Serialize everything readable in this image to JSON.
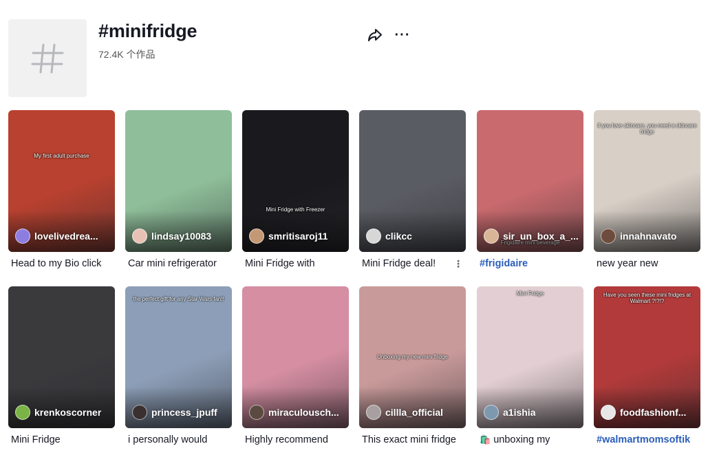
{
  "header": {
    "icon": "hashtag-icon",
    "title": "#minifridge",
    "count": "72.4K 个作品",
    "share_icon": "share-icon",
    "more_icon": "more-icon",
    "more_glyph": "···"
  },
  "videos": [
    {
      "user": "lovelivedrea...",
      "caption": "Head to my Bio click",
      "overlay": "My first adult purchase",
      "bg": "#b9412f",
      "avatar": "#8e7de0"
    },
    {
      "user": "lindsay10083",
      "caption": "Car mini refrigerator",
      "overlay": "",
      "bg": "#8fbf9a",
      "avatar": "#e7c2b4"
    },
    {
      "user": "smritisaroj11",
      "caption": "Mini Fridge with",
      "overlay": "Mini Fridge with Freezer",
      "bg": "#1a1a1e",
      "avatar": "#c49873"
    },
    {
      "user": "clikcc",
      "caption": "Mini Fridge deal!",
      "overlay": "",
      "bg": "#5a5c63",
      "avatar": "#d7d7d7"
    },
    {
      "user": "sir_un_box_a_...",
      "caption": "#frigidaire",
      "overlay": "Frigidaire mini beverage",
      "bg": "#c96a6e",
      "avatar": "#d9b598"
    },
    {
      "user": "innahnavato",
      "caption": "new year new",
      "overlay": "if you love skincare, you need a skincare fridge",
      "bg": "#d8cfc6",
      "avatar": "#6d4b3d"
    },
    {
      "user": "krenkoscorner",
      "caption": "Mini Fridge",
      "overlay": "",
      "bg": "#3a3a3d",
      "avatar": "#7bb346"
    },
    {
      "user": "princess_jpuff",
      "caption": "i personally would",
      "overlay": "the perfect gift for any Star Wars fan!!",
      "bg": "#8d9fb8",
      "avatar": "#3b3030"
    },
    {
      "user": "miraculousch...",
      "caption": "Highly recommend",
      "overlay": "",
      "bg": "#d58ea2",
      "avatar": "#5b4a40"
    },
    {
      "user": "cillla_official",
      "caption": "This exact mini fridge",
      "overlay": "Unboxing my new mini fridge",
      "bg": "#c99a9a",
      "avatar": "#a8a0a0"
    },
    {
      "user": "a1ishia",
      "caption": "unboxing my",
      "overlay": "Mini Fridge",
      "bg": "#e3cfd3",
      "avatar": "#7e98b0"
    },
    {
      "user": "foodfashionf...",
      "caption": "#walmartmomsoftik",
      "overlay": "Have you seen these mini fridges at Walmart ?!?!?",
      "bg": "#b33a3a",
      "avatar": "#e7e7e7"
    }
  ]
}
